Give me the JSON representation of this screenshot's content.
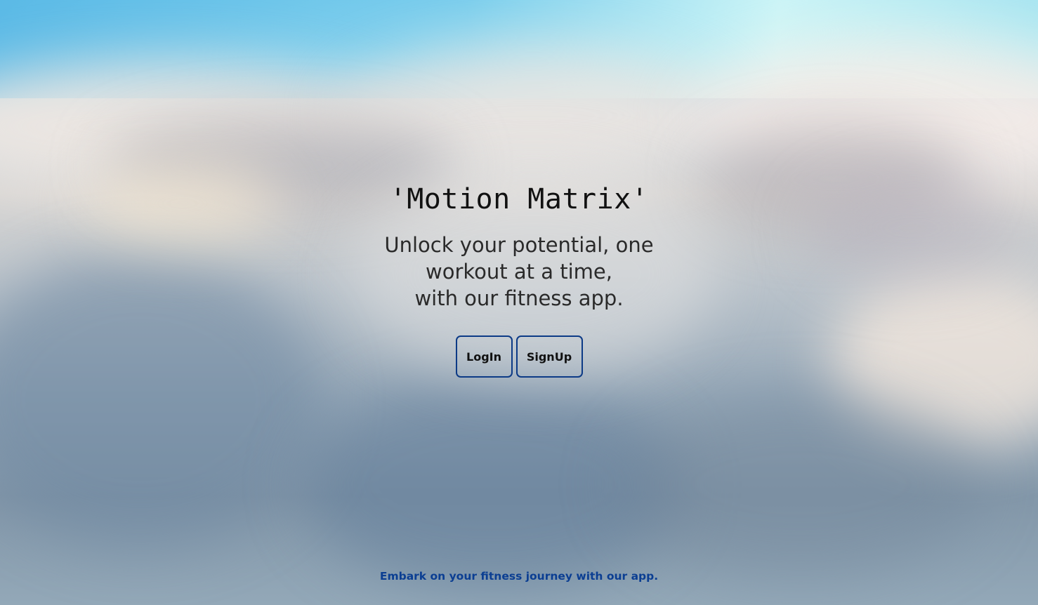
{
  "app": {
    "title": "'Motion Matrix'"
  },
  "hero": {
    "tagline_lines": [
      "Unlock your potential, one",
      "workout at a time,",
      "with our fitness app."
    ]
  },
  "actions": {
    "login_label": "LogIn",
    "signup_label": "SignUp"
  },
  "footer": {
    "text": "Embark on your fitness journey with our app."
  },
  "colors": {
    "button_border": "#0c3a86",
    "footer_text": "#0b3e92",
    "title_text": "#111111"
  }
}
